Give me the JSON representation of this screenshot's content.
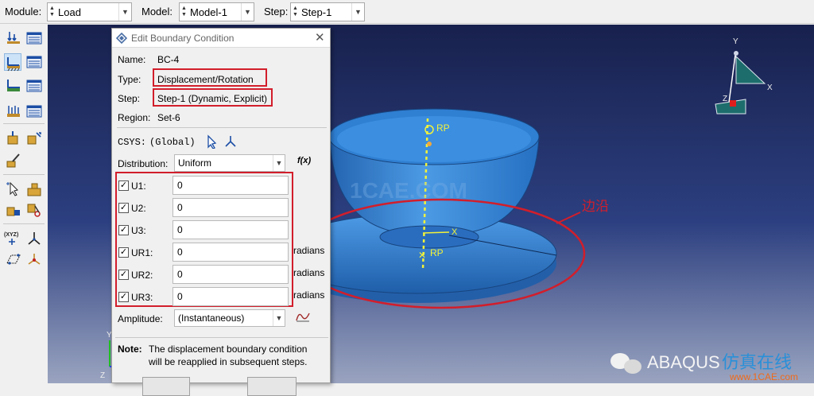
{
  "context_bar": {
    "module_label": "Module:",
    "module_value": "Load",
    "model_label": "Model:",
    "model_value": "Model-1",
    "step_label": "Step:",
    "step_value": "Step-1"
  },
  "dialog": {
    "title": "Edit Boundary Condition",
    "name_label": "Name:",
    "name_value": "BC-4",
    "type_label": "Type:",
    "type_value": "Displacement/Rotation",
    "step_label": "Step:",
    "step_value": "Step-1 (Dynamic, Explicit)",
    "region_label": "Region:",
    "region_value": "Set-6",
    "csys_label": "CSYS:",
    "csys_value": "(Global)",
    "distribution_label": "Distribution:",
    "distribution_value": "Uniform",
    "fx_label": "f(x)",
    "dofs": [
      {
        "label": "U1:",
        "value": "0",
        "checked": true,
        "unit": ""
      },
      {
        "label": "U2:",
        "value": "0",
        "checked": true,
        "unit": ""
      },
      {
        "label": "U3:",
        "value": "0",
        "checked": true,
        "unit": ""
      },
      {
        "label": "UR1:",
        "value": "0",
        "checked": true,
        "unit": "radians"
      },
      {
        "label": "UR2:",
        "value": "0",
        "checked": true,
        "unit": "radians"
      },
      {
        "label": "UR3:",
        "value": "0",
        "checked": true,
        "unit": "radians"
      }
    ],
    "amplitude_label": "Amplitude:",
    "amplitude_value": "(Instantaneous)",
    "note_label": "Note:",
    "note_line1": "The displacement boundary condition",
    "note_line2": "will be reapplied in subsequent steps."
  },
  "viewport": {
    "rp_top": "RP",
    "rp_bottom": "RP",
    "axis_x": "X",
    "axis_y": "Y",
    "axis_z": "Z",
    "triad_y": "Y",
    "triad_x": "X",
    "triad_z": "Z",
    "annotation": "边沿",
    "watermark_center": "1CAE.COM",
    "watermark_brand": "ABAQUS",
    "watermark_cn": "仿真在线",
    "watermark_url": "www.1CAE.com",
    "colors": {
      "background": "#26346e",
      "part": "#2f7fd2",
      "highlight": "#d21e2b",
      "reference": "#f2f23a"
    }
  }
}
